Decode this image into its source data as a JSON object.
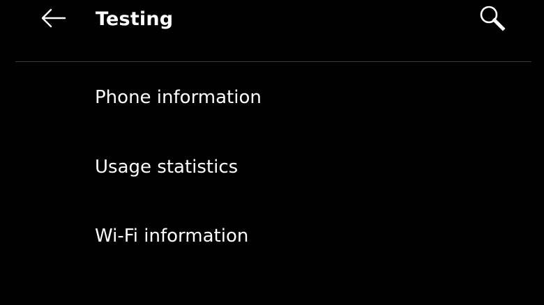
{
  "app_bar": {
    "title": "Testing",
    "back_icon": "arrow-left-icon",
    "search_icon": "search-icon"
  },
  "menu": {
    "items": [
      {
        "label": "Phone information"
      },
      {
        "label": "Usage statistics"
      },
      {
        "label": "Wi-Fi information"
      }
    ]
  },
  "colors": {
    "background": "#000000",
    "text": "#ffffff",
    "divider": "#3a3a3a"
  }
}
